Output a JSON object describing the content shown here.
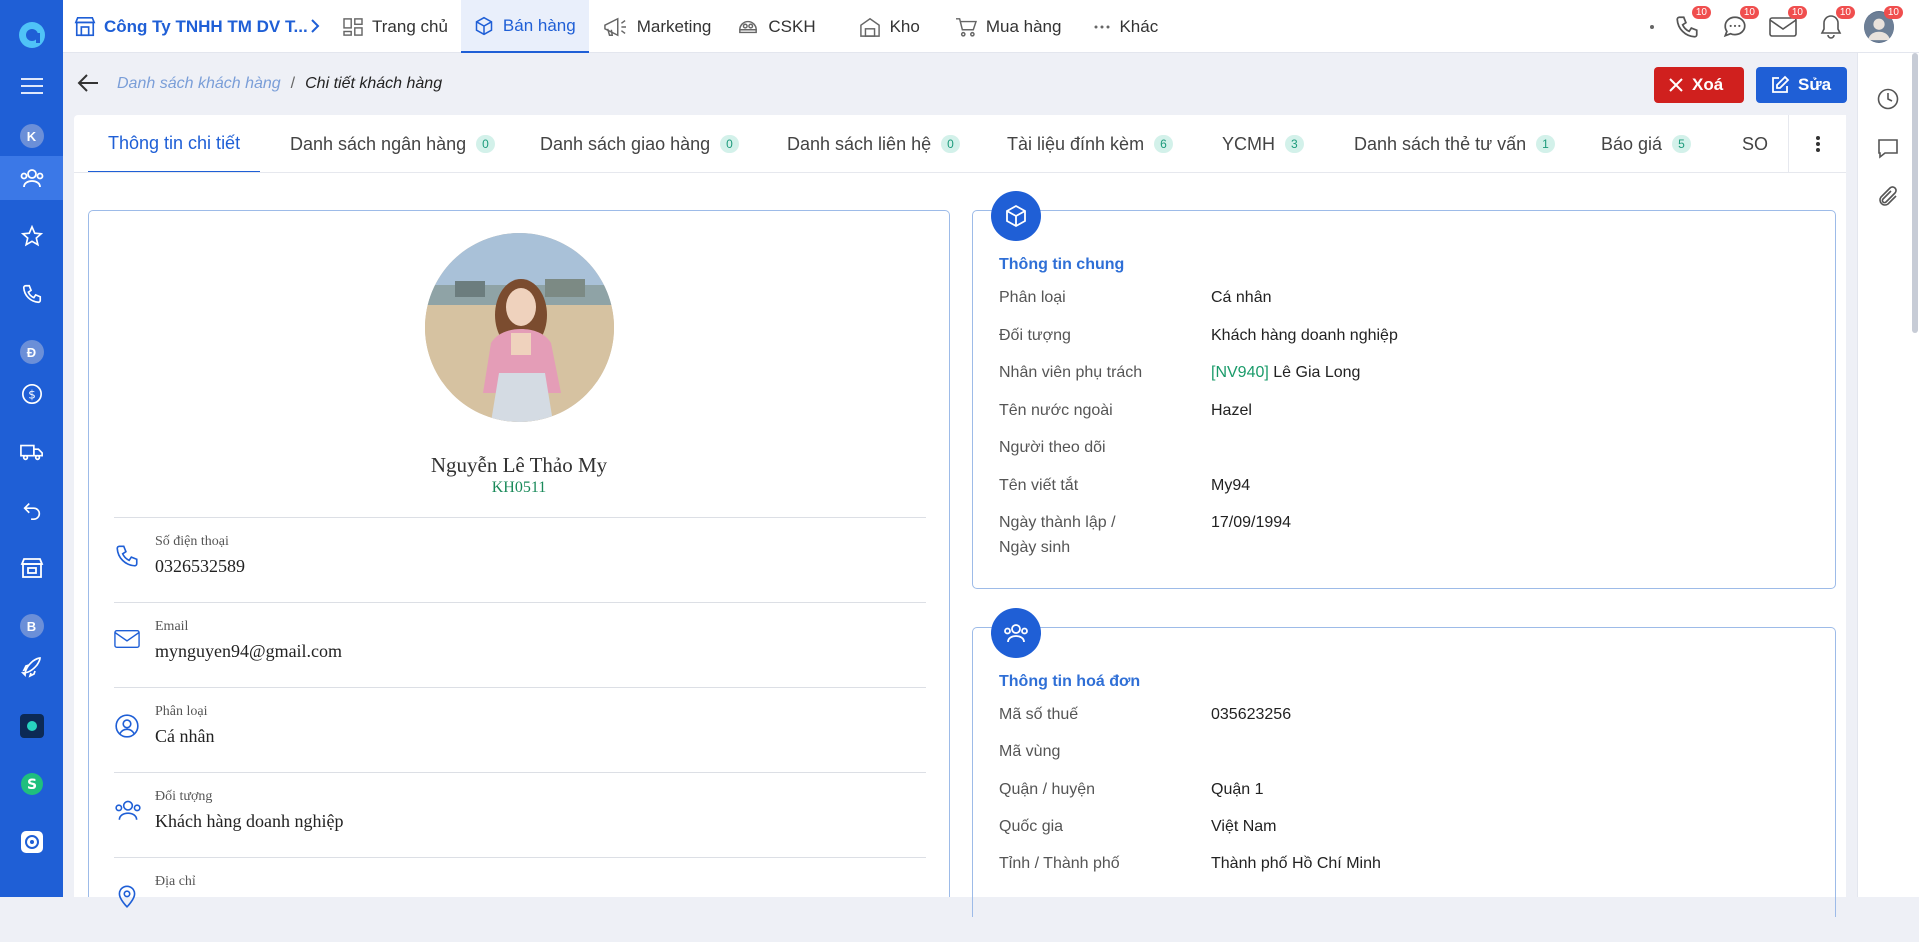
{
  "header": {
    "company": "Công Ty TNHH TM DV T...",
    "nav": [
      {
        "label": "Trang chủ",
        "icon": "home-grid-icon"
      },
      {
        "label": "Bán hàng",
        "icon": "box-icon",
        "active": true
      },
      {
        "label": "Marketing",
        "icon": "megaphone-icon"
      },
      {
        "label": "CSKH",
        "icon": "customer-care-icon"
      },
      {
        "label": "Kho",
        "icon": "warehouse-icon"
      },
      {
        "label": "Mua hàng",
        "icon": "cart-icon"
      },
      {
        "label": "Khác",
        "icon": "more-icon"
      }
    ],
    "badges": {
      "phone": "10",
      "chat": "10",
      "mail": "10",
      "bell": "10",
      "avatar": "10"
    }
  },
  "sidebar": {
    "letters": {
      "k": "K",
      "d": "Đ",
      "b": "B"
    }
  },
  "breadcrumb": {
    "parent": "Danh sách khách hàng",
    "separator": "/",
    "current": "Chi tiết khách hàng"
  },
  "actions": {
    "delete": "Xoá",
    "edit": "Sửa"
  },
  "tabs": [
    {
      "label": "Thông tin chi tiết",
      "count": null,
      "active": true
    },
    {
      "label": "Danh sách ngân hàng",
      "count": "0"
    },
    {
      "label": "Danh sách giao hàng",
      "count": "0"
    },
    {
      "label": "Danh sách liên hệ",
      "count": "0"
    },
    {
      "label": "Tài liệu đính kèm",
      "count": "6"
    },
    {
      "label": "YCMH",
      "count": "3"
    },
    {
      "label": "Danh sách thẻ tư vấn",
      "count": "1"
    },
    {
      "label": "Báo giá",
      "count": "5"
    },
    {
      "label": "SO",
      "count": null
    }
  ],
  "profile": {
    "name": "Nguyễn Lê Thảo My",
    "code": "KH0511",
    "rows": [
      {
        "label": "Số điện thoại",
        "value": "0326532589",
        "icon": "phone-icon"
      },
      {
        "label": "Email",
        "value": "mynguyen94@gmail.com",
        "icon": "mail-icon"
      },
      {
        "label": "Phân loại",
        "value": "Cá nhân",
        "icon": "user-circle-icon"
      },
      {
        "label": "Đối tượng",
        "value": "Khách hàng doanh nghiệp",
        "icon": "group-icon"
      },
      {
        "label": "Địa chỉ",
        "value": "",
        "icon": "location-icon"
      }
    ]
  },
  "general": {
    "title": "Thông tin chung",
    "rows": [
      {
        "label": "Phân loại",
        "value": "Cá nhân"
      },
      {
        "label": "Đối tượng",
        "value": "Khách hàng doanh nghiệp"
      },
      {
        "label": "Nhân viên phụ trách",
        "tag": "[NV940]",
        "value": " Lê Gia Long"
      },
      {
        "label": "Tên nước ngoài",
        "value": "Hazel"
      },
      {
        "label": "Người theo dõi",
        "value": ""
      },
      {
        "label": "Tên viết tắt",
        "value": "My94"
      },
      {
        "label": "Ngày thành lập / Ngày sinh",
        "value": "17/09/1994"
      }
    ]
  },
  "invoice": {
    "title": "Thông tin hoá đơn",
    "rows": [
      {
        "label": "Mã số thuế",
        "value": "035623256"
      },
      {
        "label": "Mã vùng",
        "value": ""
      },
      {
        "label": "Quận / huyện",
        "value": "Quận 1"
      },
      {
        "label": "Quốc gia",
        "value": "Việt Nam"
      },
      {
        "label": "Tỉnh / Thành phố",
        "value": "Thành phố Hồ Chí Minh"
      }
    ]
  }
}
